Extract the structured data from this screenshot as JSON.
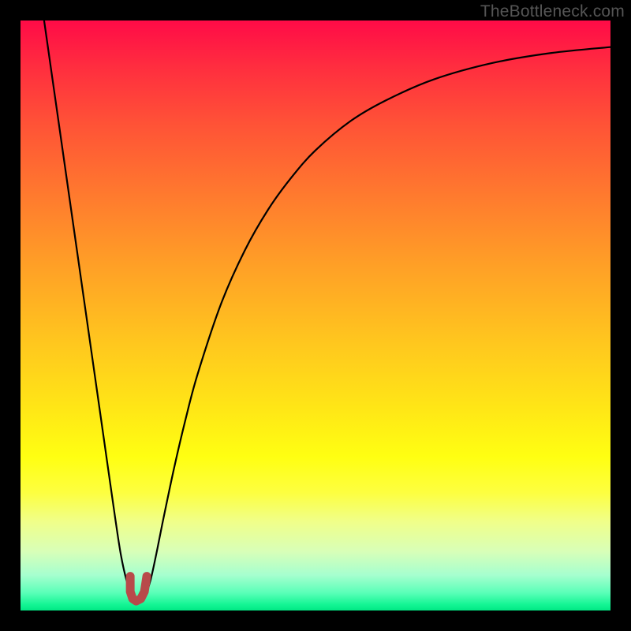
{
  "watermark": "TheBottleneck.com",
  "colors": {
    "background": "#000000",
    "curve_stroke": "#000000",
    "marker_stroke": "#b84a4a",
    "gradient_top": "#ff0b47",
    "gradient_bottom": "#00e884"
  },
  "chart_data": {
    "type": "line",
    "title": "",
    "xlabel": "",
    "ylabel": "",
    "xlim": [
      0,
      100
    ],
    "ylim": [
      0,
      100
    ],
    "series": [
      {
        "name": "curve",
        "x": [
          4,
          6,
          8,
          10,
          12,
          14,
          16,
          17,
          18,
          19,
          20,
          21,
          22,
          23,
          24,
          26,
          28,
          30,
          34,
          38,
          42,
          46,
          50,
          56,
          62,
          70,
          80,
          90,
          100
        ],
        "y": [
          100,
          86,
          72,
          58,
          44,
          30,
          16,
          9.5,
          5,
          2.3,
          1.5,
          2.3,
          5,
          9.5,
          14.5,
          24,
          32.5,
          40,
          52,
          61,
          68,
          73.5,
          78,
          83,
          86.5,
          90,
          92.8,
          94.5,
          95.5
        ]
      },
      {
        "name": "marker-U",
        "x": [
          18.6,
          18.6,
          19.0,
          19.6,
          20.4,
          21.0,
          21.4,
          21.4
        ],
        "y": [
          5.8,
          3.2,
          2.0,
          1.6,
          2.0,
          3.2,
          5.8,
          5.8
        ]
      }
    ],
    "annotations": []
  }
}
